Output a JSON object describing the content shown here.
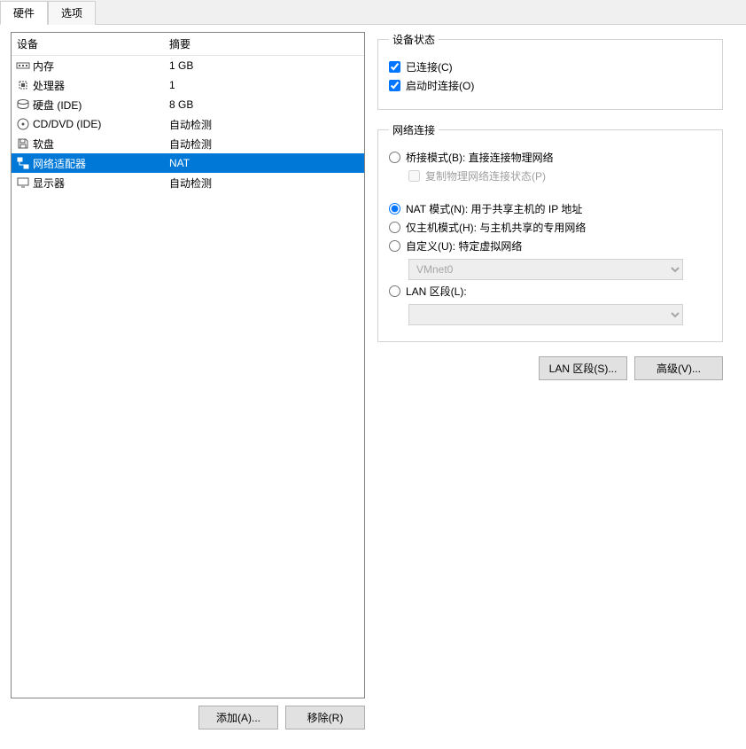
{
  "tabs": {
    "hardware": "硬件",
    "options": "选项"
  },
  "headers": {
    "device": "设备",
    "summary": "摘要"
  },
  "devices": [
    {
      "label": "内存",
      "summary": "1 GB",
      "icon": "memory"
    },
    {
      "label": "处理器",
      "summary": "1",
      "icon": "cpu"
    },
    {
      "label": "硬盘 (IDE)",
      "summary": "8 GB",
      "icon": "disk"
    },
    {
      "label": "CD/DVD (IDE)",
      "summary": "自动检测",
      "icon": "cd"
    },
    {
      "label": "软盘",
      "summary": "自动检测",
      "icon": "floppy"
    },
    {
      "label": "网络适配器",
      "summary": "NAT",
      "icon": "net",
      "selected": true
    },
    {
      "label": "显示器",
      "summary": "自动检测",
      "icon": "monitor"
    }
  ],
  "left_buttons": {
    "add": "添加(A)...",
    "remove": "移除(R)"
  },
  "status_group": {
    "legend": "设备状态",
    "connected": "已连接(C)",
    "connect_at_power": "启动时连接(O)"
  },
  "net_group": {
    "legend": "网络连接",
    "bridged": "桥接模式(B): 直接连接物理网络",
    "replicate": "复制物理网络连接状态(P)",
    "nat": "NAT 模式(N): 用于共享主机的 IP 地址",
    "hostonly": "仅主机模式(H): 与主机共享的专用网络",
    "custom": "自定义(U): 特定虚拟网络",
    "custom_value": "VMnet0",
    "lanseg": "LAN 区段(L):",
    "lanseg_value": ""
  },
  "bottom_buttons": {
    "lan": "LAN 区段(S)...",
    "adv": "高级(V)..."
  }
}
